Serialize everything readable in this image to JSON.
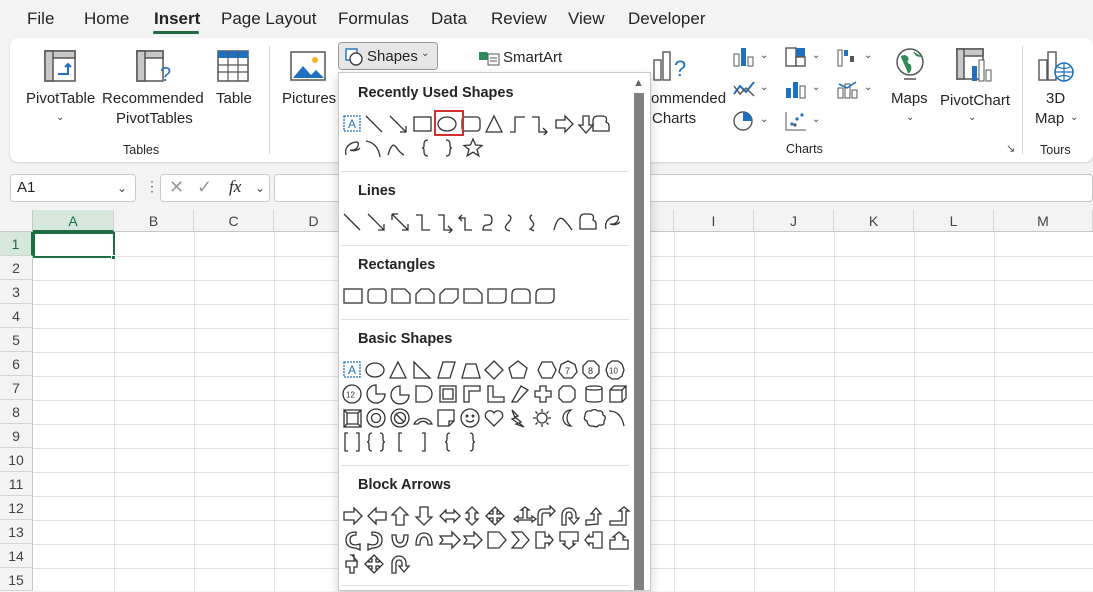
{
  "menubar": {
    "items": [
      "File",
      "Home",
      "Insert",
      "Page Layout",
      "Formulas",
      "Data",
      "Review",
      "View",
      "Developer"
    ],
    "active": "Insert"
  },
  "ribbon": {
    "pivottable": "PivotTable",
    "recommended_pivottables_1": "Recommended",
    "recommended_pivottables_2": "PivotTables",
    "table": "Table",
    "tables_group": "Tables",
    "pictures": "Pictures",
    "shapes": "Shapes",
    "smartart": "SmartArt",
    "recommended_charts_1": "ommended",
    "recommended_charts_2": "Charts",
    "maps": "Maps",
    "pivotchart": "PivotChart",
    "charts_group": "Charts",
    "map3d_1": "3D",
    "map3d_2": "Map",
    "tours_group": "Tours"
  },
  "formula_bar": {
    "name_box": "A1",
    "fx": "fx",
    "value": ""
  },
  "grid": {
    "columns": [
      "A",
      "B",
      "C",
      "D",
      "I",
      "J",
      "K",
      "L",
      "M"
    ],
    "rows": [
      "1",
      "2",
      "3",
      "4",
      "5",
      "6",
      "7",
      "8",
      "9",
      "10",
      "11",
      "12",
      "13",
      "14",
      "15"
    ],
    "selected_cell": "A1"
  },
  "shapes_dropdown": {
    "sections": {
      "recent": "Recently Used Shapes",
      "lines": "Lines",
      "rectangles": "Rectangles",
      "basic": "Basic Shapes",
      "block_arrows": "Block Arrows"
    },
    "highlighted_shape": "oval",
    "highlight_color": "#d32f2f",
    "basic_numbers": [
      "7",
      "8",
      "10",
      "12"
    ],
    "text_box_glyph": "A"
  },
  "colors": {
    "accent": "#1e6c41",
    "selection_border": "#1e6c41"
  }
}
